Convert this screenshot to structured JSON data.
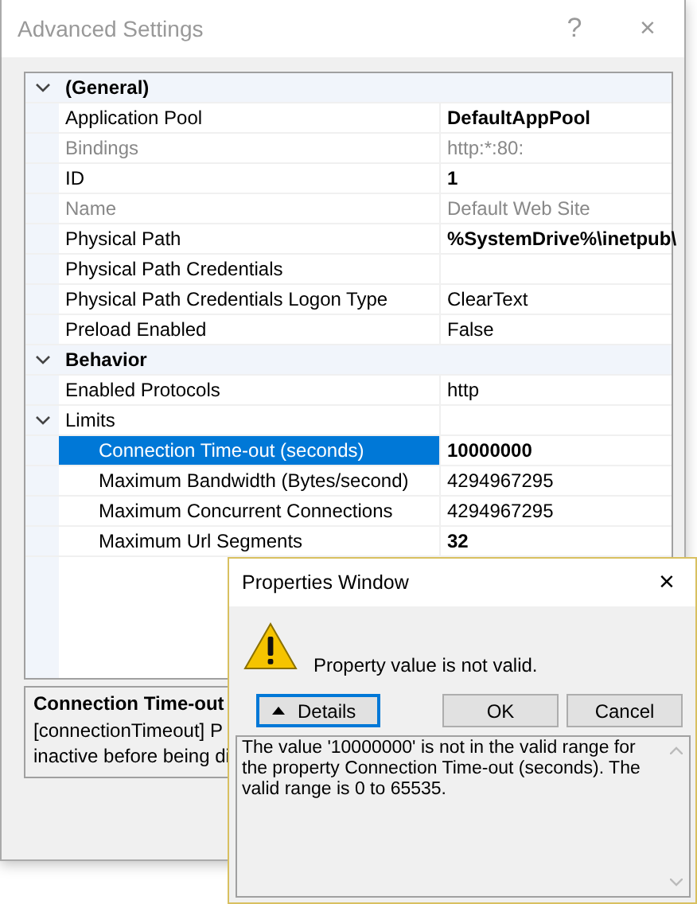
{
  "window": {
    "title": "Advanced Settings",
    "help_button": "?",
    "close_button": "×"
  },
  "categories": [
    {
      "title": "(General)",
      "expanded": true,
      "properties": [
        {
          "name": "Application Pool",
          "value": "DefaultAppPool",
          "modified": true,
          "readonly": false,
          "selected": false
        },
        {
          "name": "Bindings",
          "value": "http:*:80:",
          "modified": false,
          "readonly": true,
          "selected": false
        },
        {
          "name": "ID",
          "value": "1",
          "modified": true,
          "readonly": false,
          "selected": false
        },
        {
          "name": "Name",
          "value": "Default Web Site",
          "modified": false,
          "readonly": true,
          "selected": false
        },
        {
          "name": "Physical Path",
          "value": "%SystemDrive%\\inetpub\\",
          "modified": true,
          "readonly": false,
          "selected": false
        },
        {
          "name": "Physical Path Credentials",
          "readonly": false,
          "selected": false
        },
        {
          "name": "Physical Path Credentials Logon Type",
          "value": "ClearText",
          "modified": false,
          "readonly": false,
          "selected": false
        },
        {
          "name": "Preload Enabled",
          "value": "False",
          "modified": false,
          "readonly": false,
          "selected": false
        }
      ]
    },
    {
      "title": "Behavior",
      "expanded": true,
      "properties": [
        {
          "name": "Enabled Protocols",
          "value": "http",
          "modified": false,
          "readonly": false,
          "selected": false
        },
        {
          "name": "Limits",
          "readonly": false,
          "selected": false,
          "expanded": true,
          "children": [
            {
              "name": "Connection Time-out (seconds)",
              "value": "10000000",
              "modified": true,
              "readonly": false,
              "selected": true
            },
            {
              "name": "Maximum Bandwidth (Bytes/second)",
              "value": "4294967295",
              "modified": false,
              "readonly": false,
              "selected": false
            },
            {
              "name": "Maximum Concurrent Connections",
              "value": "4294967295",
              "modified": false,
              "readonly": false,
              "selected": false
            },
            {
              "name": "Maximum Url Segments",
              "value": "32",
              "modified": true,
              "readonly": false,
              "selected": false
            }
          ]
        }
      ]
    }
  ],
  "description": {
    "title": "Connection Time-out",
    "lines": [
      "[connectionTimeout] P",
      "inactive before being di"
    ]
  },
  "dialog": {
    "title": "Properties Window",
    "close_button": "×",
    "message": "Property value is not valid.",
    "buttons": [
      {
        "label": "Details",
        "kind": "details",
        "focused": true
      },
      {
        "label": "OK",
        "kind": "plain",
        "focused": false
      },
      {
        "label": "Cancel",
        "kind": "plain",
        "focused": false
      }
    ],
    "details": "The value '10000000' is not in the valid range for the property Connection Time-out (seconds). The valid range is 0 to 65535."
  }
}
